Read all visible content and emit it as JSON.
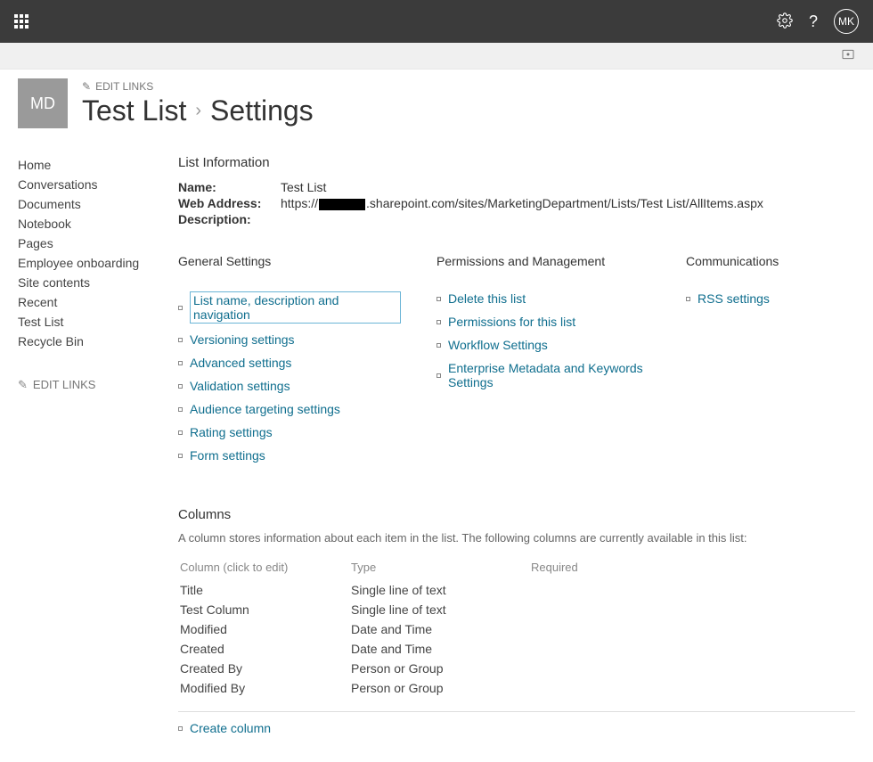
{
  "topbar": {
    "avatar_initials": "MK"
  },
  "header": {
    "edit_links": "EDIT LINKS",
    "site_logo_text": "MD",
    "title_link": "Test List",
    "title_current": "Settings"
  },
  "sidebar": {
    "items": [
      {
        "label": "Home"
      },
      {
        "label": "Conversations"
      },
      {
        "label": "Documents"
      },
      {
        "label": "Notebook"
      },
      {
        "label": "Pages"
      },
      {
        "label": "Employee onboarding"
      },
      {
        "label": "Site contents"
      },
      {
        "label": "Recent"
      },
      {
        "label": "Test List"
      },
      {
        "label": "Recycle Bin"
      }
    ],
    "edit_links": "EDIT LINKS"
  },
  "list_info": {
    "heading": "List Information",
    "name_label": "Name:",
    "name_value": "Test List",
    "address_label": "Web Address:",
    "address_prefix": "https://",
    "address_suffix": ".sharepoint.com/sites/MarketingDepartment/Lists/Test List/AllItems.aspx",
    "description_label": "Description:",
    "description_value": ""
  },
  "settings_groups": {
    "general": {
      "heading": "General Settings",
      "links": [
        {
          "label": "List name, description and navigation",
          "highlighted": true
        },
        {
          "label": "Versioning settings"
        },
        {
          "label": "Advanced settings"
        },
        {
          "label": "Validation settings"
        },
        {
          "label": "Audience targeting settings"
        },
        {
          "label": "Rating settings"
        },
        {
          "label": "Form settings"
        }
      ]
    },
    "permissions": {
      "heading": "Permissions and Management",
      "links": [
        {
          "label": "Delete this list"
        },
        {
          "label": "Permissions for this list"
        },
        {
          "label": "Workflow Settings"
        },
        {
          "label": "Enterprise Metadata and Keywords Settings"
        }
      ]
    },
    "communications": {
      "heading": "Communications",
      "links": [
        {
          "label": "RSS settings"
        }
      ]
    }
  },
  "columns_section": {
    "heading": "Columns",
    "description": "A column stores information about each item in the list. The following columns are currently available in this list:",
    "headers": {
      "col": "Column (click to edit)",
      "type": "Type",
      "required": "Required"
    },
    "rows": [
      {
        "name": "Title",
        "type": "Single line of text",
        "required": ""
      },
      {
        "name": "Test Column",
        "type": "Single line of text",
        "required": ""
      },
      {
        "name": "Modified",
        "type": "Date and Time",
        "required": ""
      },
      {
        "name": "Created",
        "type": "Date and Time",
        "required": ""
      },
      {
        "name": "Created By",
        "type": "Person or Group",
        "required": ""
      },
      {
        "name": "Modified By",
        "type": "Person or Group",
        "required": ""
      }
    ],
    "create_column": "Create column"
  }
}
